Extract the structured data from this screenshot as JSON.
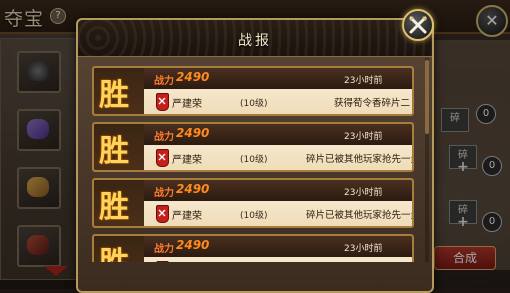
{
  "background": {
    "title": "夺宝",
    "help_glyph": "?",
    "close_glyph": "✕",
    "sui_label": "碎",
    "counts": [
      "0",
      "0",
      "0"
    ],
    "synth_label": "合成"
  },
  "modal": {
    "title": "战报"
  },
  "reports": [
    {
      "badge": "胜",
      "power_label": "战力",
      "power": "2490",
      "time": "23小时前",
      "name": "严建荣",
      "level": "(10级)",
      "result": "获得荀令香碎片二"
    },
    {
      "badge": "胜",
      "power_label": "战力",
      "power": "2490",
      "time": "23小时前",
      "name": "严建荣",
      "level": "(10级)",
      "result": "碎片已被其他玩家抢先一步"
    },
    {
      "badge": "胜",
      "power_label": "战力",
      "power": "2490",
      "time": "23小时前",
      "name": "严建荣",
      "level": "(10级)",
      "result": "碎片已被其他玩家抢先一步"
    },
    {
      "badge": "胜",
      "power_label": "战力",
      "power": "2490",
      "time": "23小时前",
      "name": "",
      "level": "",
      "result": ""
    }
  ],
  "colors": {
    "win_gold": "#ffd45a",
    "power_orange": "#ff8a1e",
    "card_bg": "#f5e6c8",
    "accent_border": "#b8995c"
  }
}
